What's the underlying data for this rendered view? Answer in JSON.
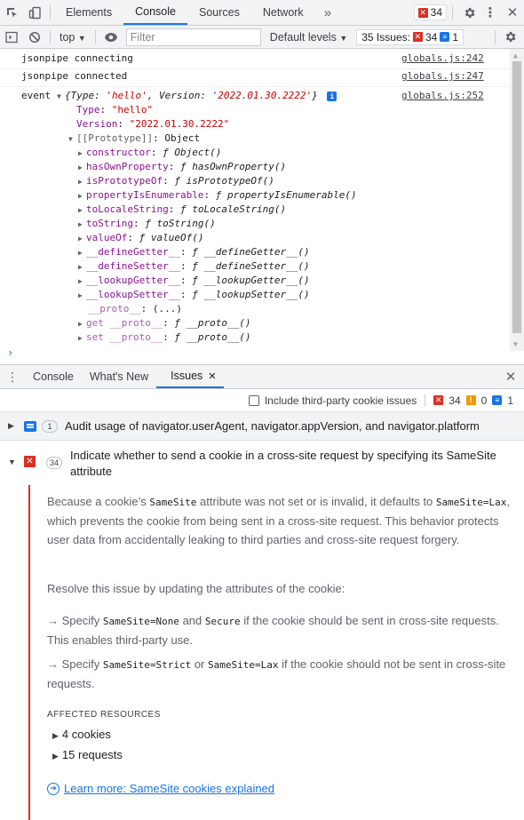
{
  "topbar": {
    "tabs": [
      {
        "label": "Elements",
        "active": false
      },
      {
        "label": "Console",
        "active": true
      },
      {
        "label": "Sources",
        "active": false
      },
      {
        "label": "Network",
        "active": false
      }
    ],
    "more": "»",
    "error_count": "34"
  },
  "toolbar": {
    "context": "top",
    "filter_placeholder": "Filter",
    "levels": "Default levels",
    "issues_label": "35 Issues:",
    "issues_errors": "34",
    "issues_info": "1"
  },
  "console": {
    "lines": [
      {
        "text": "jsonpipe connecting",
        "source": "globals.js:242"
      },
      {
        "text": "jsonpipe connected",
        "source": "globals.js:247"
      }
    ],
    "event": {
      "label": "event",
      "summary_open": "{",
      "summary_type_key": "Type: ",
      "summary_type_val": "'hello'",
      "summary_comma": ", ",
      "summary_ver_key": "Version: ",
      "summary_ver_val": "'2022.01.30.2222'",
      "summary_close": "}",
      "source": "globals.js:252",
      "type_key": "Type",
      "type_val": "\"hello\"",
      "version_key": "Version",
      "version_val": "\"2022.01.30.2222\"",
      "proto_key": "[[Prototype]]",
      "proto_val": "Object",
      "members": [
        {
          "key": "constructor",
          "val": "ƒ Object()"
        },
        {
          "key": "hasOwnProperty",
          "val": "ƒ hasOwnProperty()"
        },
        {
          "key": "isPrototypeOf",
          "val": "ƒ isPrototypeOf()"
        },
        {
          "key": "propertyIsEnumerable",
          "val": "ƒ propertyIsEnumerable()"
        },
        {
          "key": "toLocaleString",
          "val": "ƒ toLocaleString()"
        },
        {
          "key": "toString",
          "val": "ƒ toString()"
        },
        {
          "key": "valueOf",
          "val": "ƒ valueOf()"
        },
        {
          "key": "__defineGetter__",
          "val": "ƒ __defineGetter__()"
        },
        {
          "key": "__defineSetter__",
          "val": "ƒ __defineSetter__()"
        },
        {
          "key": "__lookupGetter__",
          "val": "ƒ __lookupGetter__()"
        },
        {
          "key": "__lookupSetter__",
          "val": "ƒ __lookupSetter__()"
        }
      ],
      "proto_accessor_key": "__proto__",
      "proto_accessor_val": "(...)",
      "getter_key": "get __proto__",
      "getter_val": "ƒ __proto__()",
      "setter_key": "set __proto__",
      "setter_val": "ƒ __proto__()"
    }
  },
  "drawer": {
    "tabs": [
      {
        "label": "Console",
        "active": false
      },
      {
        "label": "What's New",
        "active": false
      },
      {
        "label": "Issues",
        "active": true
      }
    ]
  },
  "issues_toolbar": {
    "checkbox_label": "Include third-party cookie issues",
    "errors": "34",
    "warnings": "0",
    "info": "1"
  },
  "issues": [
    {
      "count": "1",
      "title": "Audit usage of navigator.userAgent, navigator.appVersion, and navigator.platform"
    },
    {
      "count": "34",
      "title": "Indicate whether to send a cookie in a cross-site request by specifying its SameSite attribute"
    }
  ],
  "detail": {
    "p1_a": "Because a cookie’s ",
    "p1_code1": "SameSite",
    "p1_b": " attribute was not set or is invalid, it defaults to ",
    "p1_code2": "SameSite=Lax",
    "p1_c": ", which prevents the cookie from being sent in a cross-site request. This behavior protects user data from accidentally leaking to third parties and cross-site request forgery.",
    "p2": "Resolve this issue by updating the attributes of the cookie:",
    "p3_a": "→ Specify ",
    "p3_code1": "SameSite=None",
    "p3_b": " and ",
    "p3_code2": "Secure",
    "p3_c": " if the cookie should be sent in cross-site requests. This enables third-party use.",
    "p4_a": "→ Specify ",
    "p4_code1": "SameSite=Strict",
    "p4_b": " or ",
    "p4_code2": "SameSite=Lax",
    "p4_c": " if the cookie should not be sent in cross-site requests.",
    "affected_label": "AFFECTED RESOURCES",
    "resources": [
      "4 cookies",
      "15 requests"
    ],
    "learn_more": "Learn more: SameSite cookies explained"
  },
  "colors": {
    "accent": "#1a73e8",
    "error": "#d93025",
    "warning": "#f29900",
    "purple": "#881391",
    "string": "#c80000"
  }
}
